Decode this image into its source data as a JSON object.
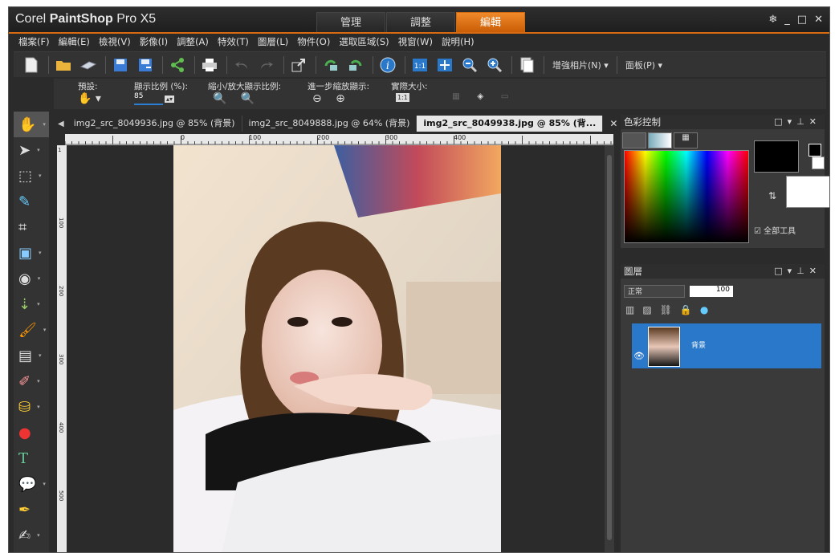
{
  "app": {
    "brand_a": "Corel ",
    "brand_b": "PaintShop",
    "brand_c": " Pro X5"
  },
  "mode_tabs": [
    "管理",
    "調整",
    "編輯"
  ],
  "menu": [
    "檔案(F)",
    "編輯(E)",
    "檢視(V)",
    "影像(I)",
    "調整(A)",
    "特效(T)",
    "圖層(L)",
    "物件(O)",
    "選取區域(S)",
    "視窗(W)",
    "說明(H)"
  ],
  "toolbar": {
    "enhance": "增強相片(N) ▾",
    "palettes": "面板(P) ▾"
  },
  "options": {
    "presets": "預設:",
    "zoom_pct": "顯示比例 (%):",
    "zoom_value": "85",
    "zoom_inout": "縮小/放大顯示比例:",
    "zoom_more": "進一步縮放顯示:",
    "actual": "實際大小:"
  },
  "doc_tabs": [
    "img2_src_8049936.jpg @  85% (背景)",
    "img2_src_8049888.jpg @  64% (背景)",
    "img2_src_8049938.jpg @  85% (背..."
  ],
  "ruler": {
    "h": [
      "0",
      "100",
      "200",
      "300",
      "400"
    ],
    "v": [
      "1",
      "100",
      "200",
      "300",
      "400",
      "500"
    ]
  },
  "color_panel": {
    "title": "色彩控制",
    "all_tools": "全部工具"
  },
  "layers_panel": {
    "title": "圖層",
    "blend": "正常",
    "opacity": "100",
    "layer_name": "背景"
  },
  "colors": {
    "accent": "#d86a12",
    "layer_selected": "#2a78c9",
    "fg": "#000000",
    "bg": "#ffffff"
  }
}
